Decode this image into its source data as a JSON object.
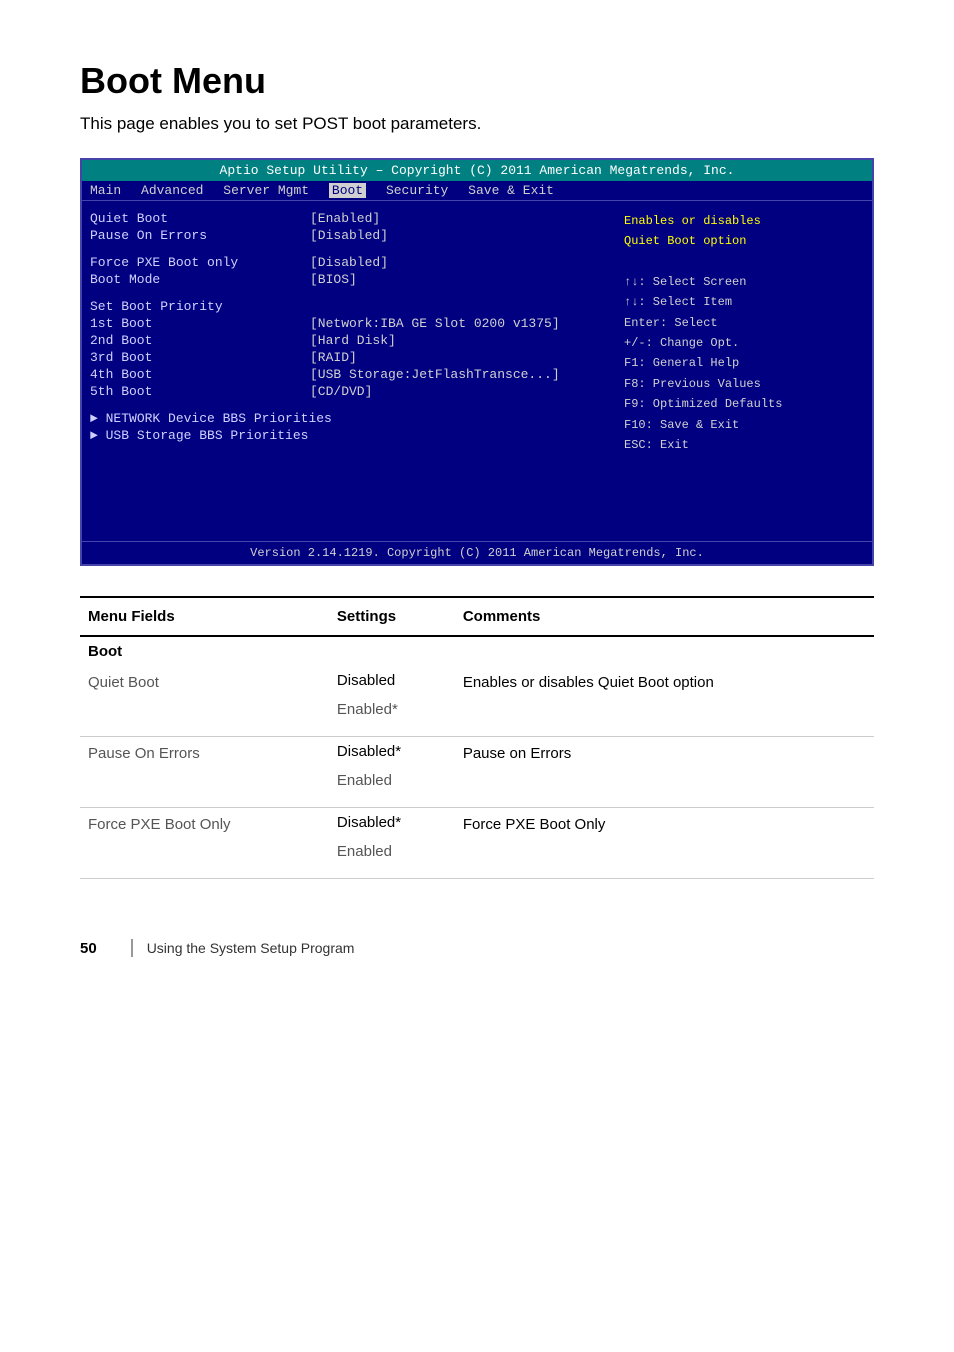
{
  "page": {
    "title": "Boot Menu",
    "subtitle": "This page enables you to set POST boot parameters.",
    "footer_page_number": "50",
    "footer_text": "Using the System Setup Program"
  },
  "bios": {
    "title_bar": "Aptio Setup Utility – Copyright (C) 2011 American Megatrends, Inc.",
    "menu_items": [
      "Main",
      "Advanced",
      "Server Mgmt",
      "Boot",
      "Security",
      "Save & Exit"
    ],
    "active_menu": "Boot",
    "fields": [
      {
        "label": "Quiet Boot",
        "value": "[Enabled]"
      },
      {
        "label": "Pause On Errors",
        "value": "[Disabled]"
      },
      {
        "label": "",
        "value": ""
      },
      {
        "label": "Force PXE Boot only",
        "value": "[Disabled]"
      },
      {
        "label": "Boot Mode",
        "value": "[BIOS]"
      },
      {
        "label": "",
        "value": ""
      },
      {
        "label": "Set Boot Priority",
        "value": ""
      },
      {
        "label": "1st Boot",
        "value": "[Network:IBA GE Slot 0200 v1375]"
      },
      {
        "label": "2nd Boot",
        "value": "[Hard Disk]"
      },
      {
        "label": "3rd Boot",
        "value": "[RAID]"
      },
      {
        "label": "4th Boot",
        "value": "[USB Storage:JetFlashTransce...]"
      },
      {
        "label": "5th Boot",
        "value": "[CD/DVD]"
      }
    ],
    "submenus": [
      "NETWORK Device BBS Priorities",
      "USB Storage BBS Priorities"
    ],
    "help_right_top": "Enables or disables\nQuiet Boot option",
    "help_keys": [
      "↑↓: Select Screen",
      "↑↓: Select Item",
      "Enter: Select",
      "+/-: Change Opt.",
      "F1: General Help",
      "F8: Previous Values",
      "F9: Optimized Defaults",
      "F10: Save & Exit",
      "ESC: Exit"
    ],
    "version_footer": "Version 2.14.1219. Copyright (C) 2011 American Megatrends, Inc."
  },
  "table": {
    "columns": [
      "Menu Fields",
      "Settings",
      "Comments"
    ],
    "sections": [
      {
        "section_name": "Boot",
        "rows": [
          {
            "field": "Quiet Boot",
            "settings": [
              "Disabled",
              "Enabled*"
            ],
            "comment": "Enables or disables Quiet Boot option"
          },
          {
            "field": "Pause On Errors",
            "settings": [
              "Disabled*",
              "Enabled"
            ],
            "comment": "Pause on Errors"
          },
          {
            "field": "Force PXE Boot Only",
            "settings": [
              "Disabled*",
              "Enabled"
            ],
            "comment": "Force PXE Boot Only"
          }
        ]
      }
    ]
  }
}
